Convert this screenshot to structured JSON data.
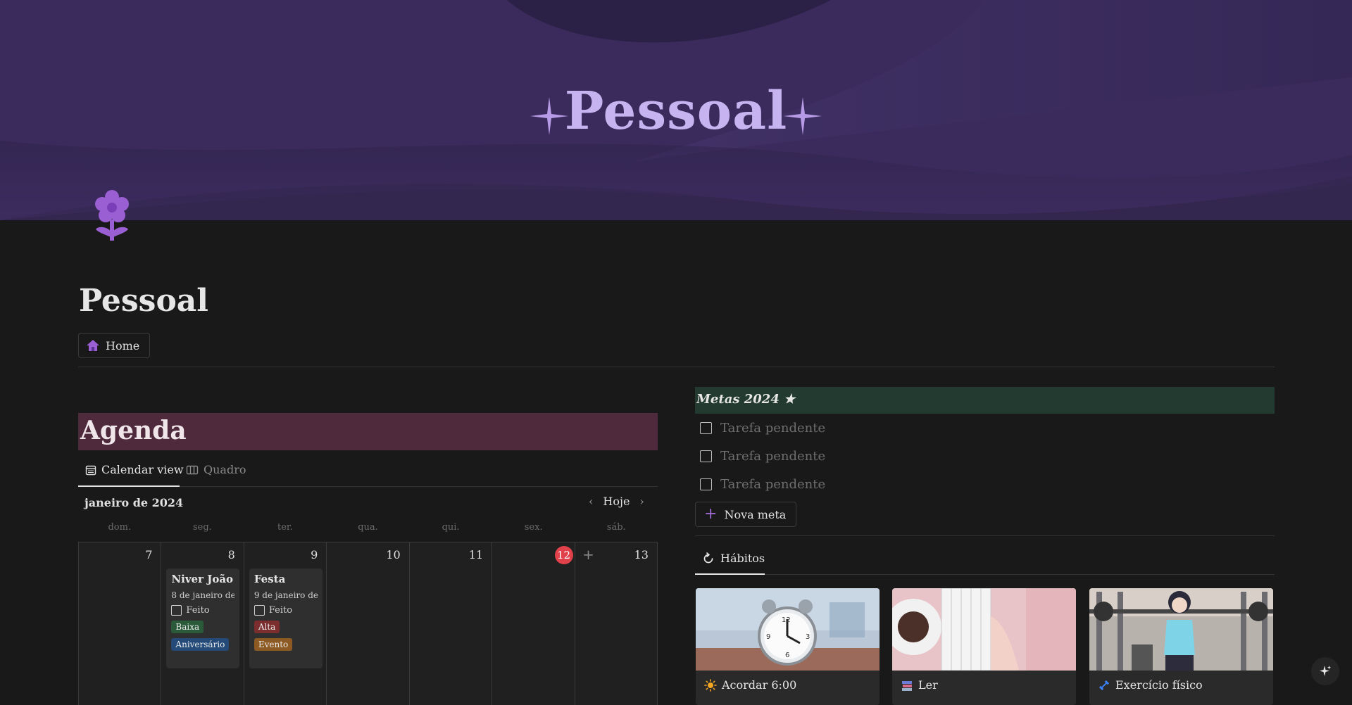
{
  "cover": {
    "title": "Pessoal"
  },
  "page": {
    "title": "Pessoal",
    "home_link": "Home"
  },
  "agenda": {
    "heading": "Agenda",
    "tabs": [
      {
        "label": "Calendar view"
      },
      {
        "label": "Quadro"
      }
    ],
    "month": "janeiro de 2024",
    "today_label": "Hoje",
    "weekdays": [
      "dom.",
      "seg.",
      "ter.",
      "qua.",
      "qui.",
      "sex.",
      "sáb."
    ],
    "days": [
      "7",
      "8",
      "9",
      "10",
      "11",
      "12",
      "13"
    ],
    "today": "12",
    "events": [
      {
        "title": "Niver João",
        "date": "8 de janeiro de",
        "check": "Feito",
        "priority": "Baixa",
        "category": "Aniversário"
      },
      {
        "title": "Festa",
        "date": "9 de janeiro de",
        "check": "Feito",
        "priority": "Alta",
        "category": "Evento"
      }
    ]
  },
  "metas": {
    "heading": "Metas 2024 ★",
    "tasks": [
      "Tarefa pendente",
      "Tarefa pendente",
      "Tarefa pendente"
    ],
    "new_label": "Nova meta"
  },
  "habitos": {
    "tab_label": "Hábitos",
    "cards": [
      {
        "label": "Acordar 6:00",
        "icon": "sun-icon"
      },
      {
        "label": "Ler",
        "icon": "books-icon"
      },
      {
        "label": "Exercício físico",
        "icon": "dumbbell-icon"
      }
    ]
  },
  "colors": {
    "cover": "#3a2b5c",
    "cover_title": "#c6b3f0",
    "agenda_header": "#4f2a3c",
    "metas_header": "#223a2f",
    "today_badge": "#e0414b",
    "accent": "#a06ad8"
  }
}
